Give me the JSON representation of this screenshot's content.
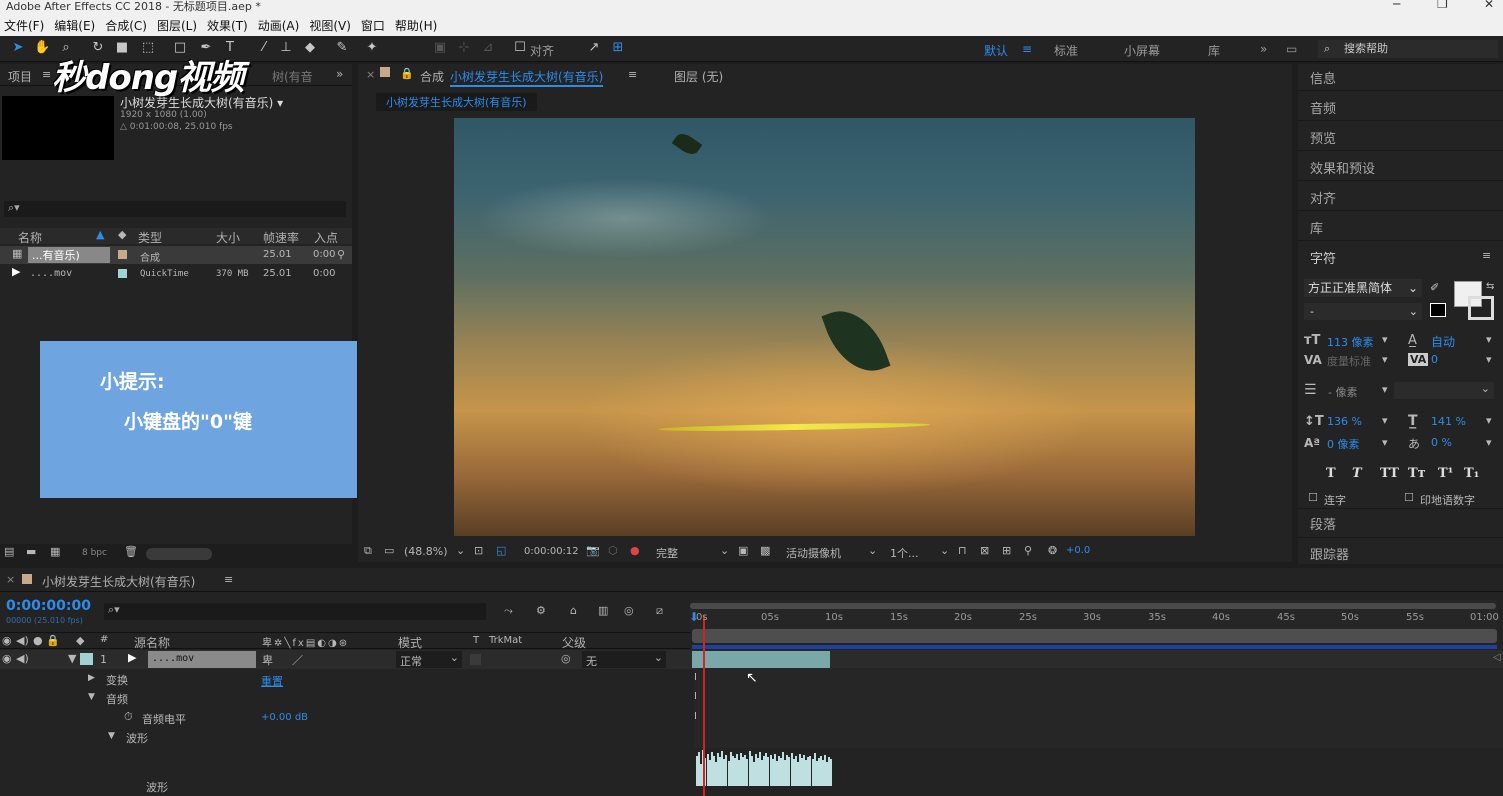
{
  "window": {
    "title": "Adobe After Effects CC 2018 - 无标题项目.aep *"
  },
  "menu": [
    "文件(F)",
    "编辑(E)",
    "合成(C)",
    "图层(L)",
    "效果(T)",
    "动画(A)",
    "视图(V)",
    "窗口",
    "帮助(H)"
  ],
  "toolbar": {
    "align_label": "对齐",
    "workspaces": [
      "默认",
      "标准",
      "小屏幕",
      "库"
    ],
    "search_placeholder": "搜索帮助"
  },
  "watermark": "秒dong视频",
  "project": {
    "tab_label": "项目",
    "tab_suffix": "树(有音",
    "comp_name": "小树发芽生长成大树(有音乐) ▾",
    "comp_size": "1920 x 1080 (1.00)",
    "comp_duration": "△ 0:01:00:08, 25.010 fps",
    "columns": [
      "名称",
      "类型",
      "大小",
      "帧速率",
      "入点"
    ],
    "rows": [
      {
        "name": "...有音乐)",
        "type": "合成",
        "size": "",
        "fps": "25.01",
        "in": "0:00"
      },
      {
        "name": "....mov",
        "type": "QuickTime",
        "size": "370 MB",
        "fps": "25.01",
        "in": "0:00"
      }
    ],
    "bpc": "8 bpc"
  },
  "hint": {
    "title": "小提示:",
    "text": "小键盘的\"0\"键"
  },
  "comp_panel": {
    "tab_prefix": "合成",
    "tab_name": "小树发芽生长成大树(有音乐)",
    "layer_tab": "图层 (无)",
    "breadcrumb": "小树发芽生长成大树(有音乐)",
    "zoom": "(48.8%)",
    "timecode": "0:00:00:12",
    "quality": "完整",
    "camera": "活动摄像机",
    "views": "1个...",
    "exposure": "+0.0"
  },
  "right_panel": {
    "items": [
      "信息",
      "音频",
      "预览",
      "效果和预设",
      "对齐",
      "库"
    ],
    "character": {
      "title": "字符",
      "font": "方正正准黑简体",
      "style": "-",
      "size": "113 像素",
      "leading": "自动",
      "kerning": "度量标准",
      "tracking": "0",
      "stroke": "- 像素",
      "vscale": "136 %",
      "hscale": "141 %",
      "baseline": "0 像素",
      "tsume": "0 %",
      "style_buttons": [
        "T",
        "T",
        "TT",
        "Tт",
        "T¹",
        "T₁"
      ],
      "ligature": "连字",
      "hindi": "印地语数字"
    },
    "paragraph": "段落",
    "tracker": "跟踪器"
  },
  "timeline": {
    "tab_name": "小树发芽生长成大树(有音乐)",
    "timecode": "0:00:00:00",
    "fps_note": "00000 (25.010 fps)",
    "col_source": "源名称",
    "col_mode": "模式",
    "col_t": "T",
    "col_trkmat": "TrkMat",
    "col_parent": "父级",
    "layer": {
      "num": "1",
      "name": "....mov",
      "mode": "正常",
      "parent": "无"
    },
    "props": {
      "transform": "变换",
      "reset": "重置",
      "audio": "音频",
      "level": "音频电平",
      "level_value": "+0.00 dB",
      "waveform": "波形",
      "waveform2": "波形"
    },
    "ruler": [
      "0s",
      "05s",
      "10s",
      "15s",
      "20s",
      "25s",
      "30s",
      "35s",
      "40s",
      "45s",
      "50s",
      "55s",
      "01:00"
    ]
  }
}
